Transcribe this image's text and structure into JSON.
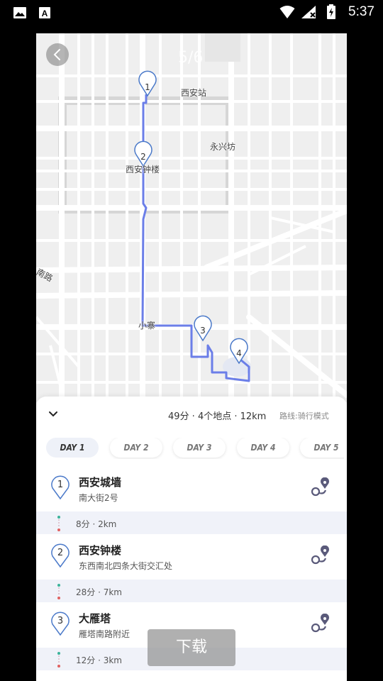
{
  "status_bar": {
    "time": "5:37"
  },
  "map": {
    "page_counter": "5/6",
    "labels": {
      "xian_station": "西安站",
      "yongxingfang": "永兴坊",
      "bell_tower": "西安钟楼",
      "south_road": "南路",
      "xiaozhai": "小寨"
    },
    "markers": [
      "1",
      "2",
      "3",
      "4"
    ],
    "route_color": "#6b7ee8"
  },
  "sheet": {
    "summary": "49分 · 4个地点 · 12km",
    "mode": "路线:骑行模式",
    "days": [
      "DAY 1",
      "DAY 2",
      "DAY 3",
      "DAY 4",
      "DAY 5"
    ],
    "active_day": "DAY 1",
    "stops": [
      {
        "num": "1",
        "name": "西安城墙",
        "address": "南大街2号"
      },
      {
        "num": "2",
        "name": "西安钟楼",
        "address": "东西南北四条大街交汇处"
      },
      {
        "num": "3",
        "name": "大雁塔",
        "address": "雁塔南路附近"
      }
    ],
    "legs": [
      "8分 · 2km",
      "28分 · 7km",
      "12分 · 3km"
    ]
  },
  "download_label": "下载"
}
